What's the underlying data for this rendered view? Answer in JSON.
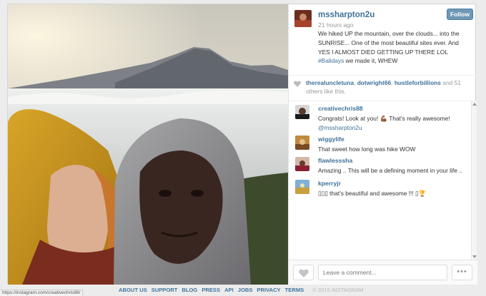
{
  "post": {
    "username": "mssharpton2u",
    "time_ago": "21 hours ago",
    "follow_label": "Follow",
    "caption": "We hiked UP the mountain, over the clouds... into the SUNRISE... One of the most beautiful sites ever. And YES I ALMOST DIED GETTING UP THERE LOL",
    "hashtag": "#Balidays",
    "caption_end": " we made it, WHEW"
  },
  "likes": {
    "user1": "therealuncletuna",
    "sep1": ", ",
    "user2": "dotwright66",
    "sep2": ", ",
    "user3": "hustleforbillions",
    "and_text": " and ",
    "count": "51",
    "others_text": " others like this."
  },
  "comments": [
    {
      "user": "creativechris88",
      "text": "Congrats! Look at you! 💪🏾 That's really awesome!",
      "mention": "@mssharpton2u"
    },
    {
      "user": "wiggylife",
      "text": "That sweet how long was hike WOW"
    },
    {
      "user": "flawlesssha",
      "text": "Amazing .. This will be a defining moment in your life .."
    },
    {
      "user": "kperryjr",
      "text": "▯▯▯ that's beautiful and awesome !!! ▯🏆"
    }
  ],
  "comment_box": {
    "placeholder": "Leave a comment...",
    "more_label": "•••"
  },
  "footer": {
    "links": [
      "ABOUT US",
      "SUPPORT",
      "BLOG",
      "PRESS",
      "API",
      "JOBS",
      "PRIVACY",
      "TERMS"
    ],
    "copyright": "© 2015 INSTAGRAM"
  },
  "status_url": "https://instagram.com/creativechris88/",
  "colors": {
    "link": "#3f729b",
    "follow": "#6f97b6"
  },
  "icons": {
    "like_count": "heart-icon",
    "like_button": "heart-icon",
    "more": "ellipsis-icon"
  }
}
